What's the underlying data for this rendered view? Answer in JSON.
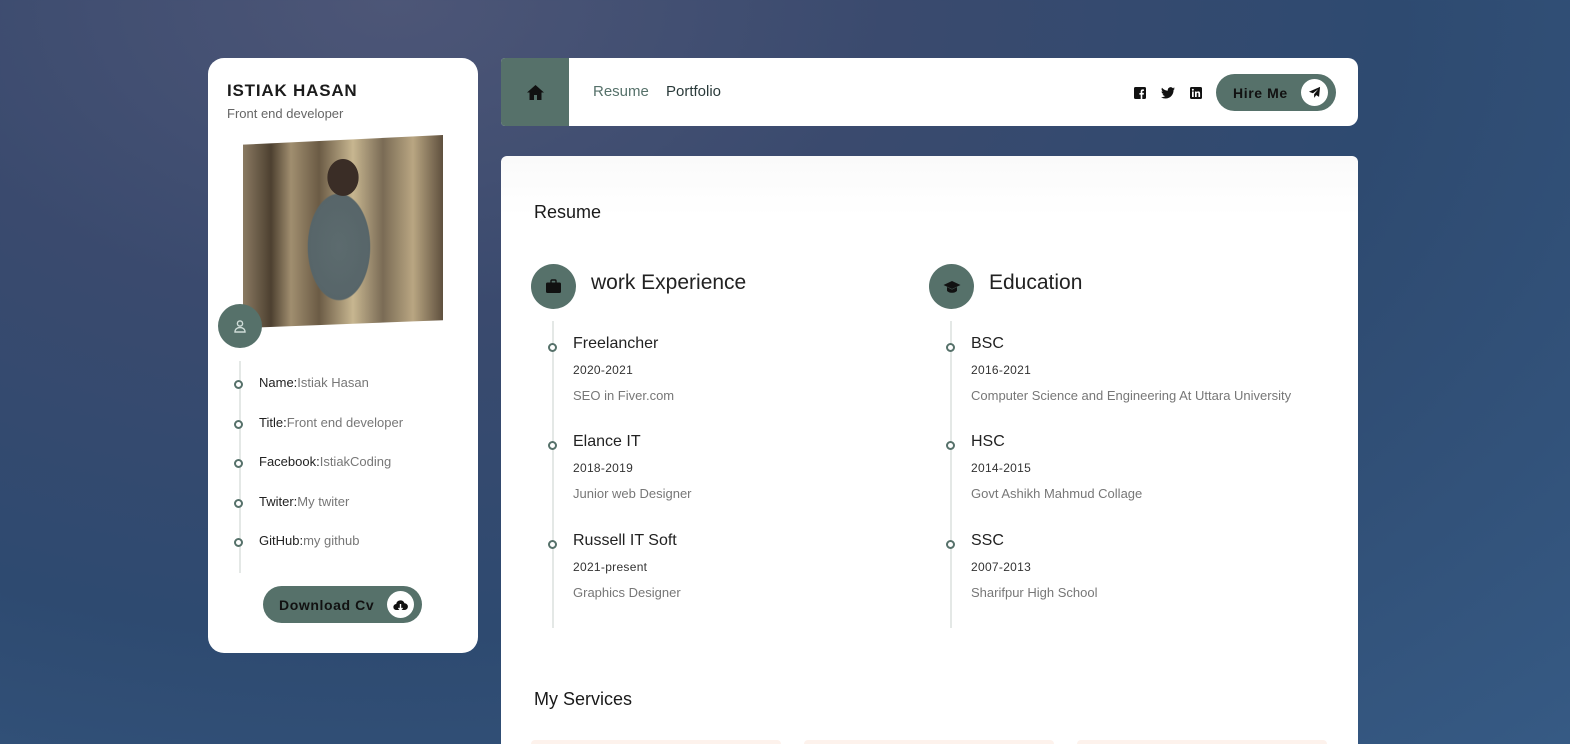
{
  "profile": {
    "name": "ISTIAK HASAN",
    "role": "Front end developer",
    "info": [
      {
        "key": "Name:",
        "value": "Istiak Hasan"
      },
      {
        "key": "Title:",
        "value": "Front end developer"
      },
      {
        "key": "Facebook:",
        "value": "IstiakCoding"
      },
      {
        "key": "Twiter:",
        "value": "My twiter"
      },
      {
        "key": "GitHub:",
        "value": "my github"
      }
    ],
    "download_label": "Download Cv"
  },
  "nav": {
    "links": [
      "Resume",
      "Portfolio"
    ],
    "social_icons": [
      "facebook-icon",
      "twitter-icon",
      "linkedin-icon"
    ],
    "hire_label": "Hire Me"
  },
  "resume": {
    "title": "Resume",
    "work": {
      "heading": "work Experience",
      "items": [
        {
          "title": "Freelancher",
          "years": "2020-2021",
          "desc": "SEO in Fiver.com"
        },
        {
          "title": "Elance IT",
          "years": "2018-2019",
          "desc": "Junior web Designer"
        },
        {
          "title": "Russell IT Soft",
          "years": "2021-present",
          "desc": "Graphics Designer"
        }
      ]
    },
    "education": {
      "heading": "Education",
      "items": [
        {
          "title": "BSC",
          "years": "2016-2021",
          "desc": "Computer Science and Engineering At Uttara University"
        },
        {
          "title": "HSC",
          "years": "2014-2015",
          "desc": "Govt Ashikh Mahmud Collage"
        },
        {
          "title": "SSC",
          "years": "2007-2013",
          "desc": "Sharifpur High School"
        }
      ]
    }
  },
  "services": {
    "title": "My Services"
  },
  "colors": {
    "accent": "#56716a",
    "card": "#ffffff",
    "service_card": "#fdf2ec"
  }
}
